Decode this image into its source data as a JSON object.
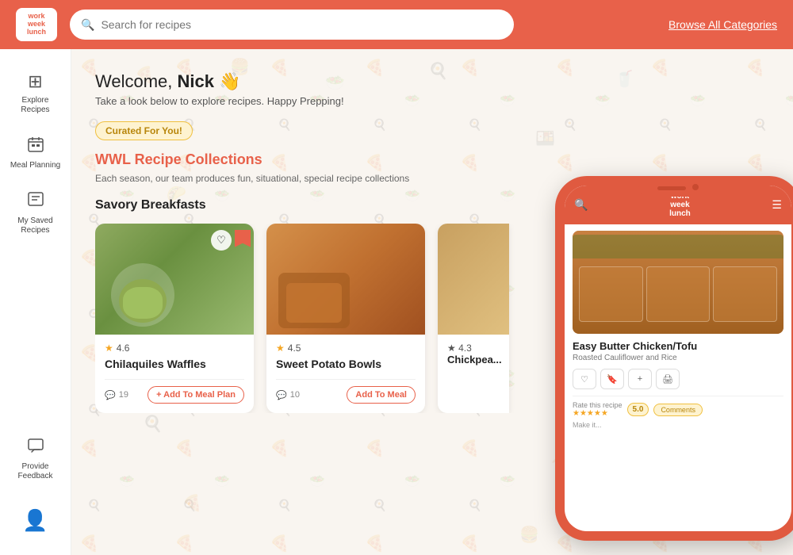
{
  "header": {
    "logo_line1": "work",
    "logo_line2": "week",
    "logo_line3": "lunch",
    "search_placeholder": "Search for recipes",
    "browse_label": "Browse All Categories"
  },
  "sidebar": {
    "items": [
      {
        "id": "explore",
        "label": "Explore Recipes",
        "icon": "⊞"
      },
      {
        "id": "meal-planning",
        "label": "Meal Planning",
        "icon": "📅"
      },
      {
        "id": "saved",
        "label": "My Saved Recipes",
        "icon": "🔖"
      },
      {
        "id": "feedback",
        "label": "Provide Feedback",
        "icon": "💬"
      }
    ],
    "user_icon": "👤"
  },
  "main": {
    "welcome_prefix": "Welcome, ",
    "welcome_name": "Nick",
    "welcome_emoji": "👋",
    "welcome_subtitle": "Take a look below to explore recipes. Happy Prepping!",
    "curated_badge": "Curated For You!",
    "collection_title": "WWL Recipe Collections",
    "collection_desc": "Each season, our team produces fun, situational, special recipe collections",
    "section_title": "Savory Breakfasts",
    "recipes": [
      {
        "id": "chilaquiles",
        "name": "Chilaquiles Waffles",
        "rating": "4.6",
        "comments": "19",
        "add_label": "+ Add To Meal Plan"
      },
      {
        "id": "sweet-potato",
        "name": "Sweet Potato Bowls",
        "rating": "4.5",
        "comments": "10",
        "add_label": "Add To Meal"
      }
    ]
  },
  "phone": {
    "recipe_title": "Easy Butter Chicken/Tofu",
    "recipe_subtitle": "Roasted Cauliflower and Rice",
    "rating_label": "Rate this recipe",
    "score": "5.0",
    "comments_label": "Comments",
    "make_label": "Make it...",
    "actions": [
      "♡",
      "🔖",
      "+",
      "🖨"
    ]
  }
}
